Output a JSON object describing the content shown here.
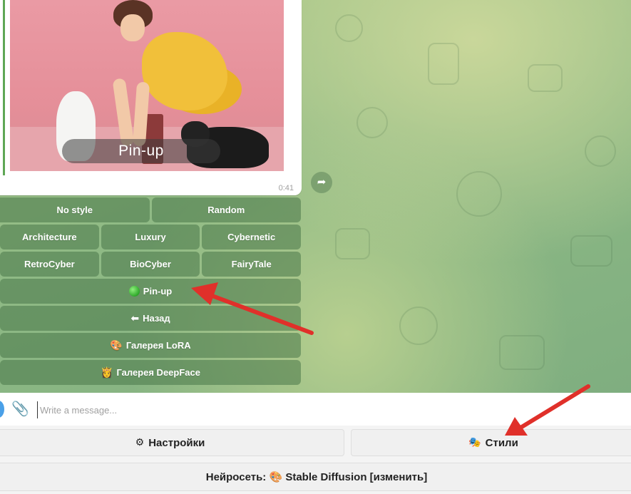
{
  "message": {
    "image_caption": "Pin-up",
    "time": "0:41"
  },
  "inline_keyboard": {
    "rows": [
      [
        "No style",
        "Random"
      ],
      [
        "Architecture",
        "Luxury",
        "Cybernetic"
      ],
      [
        "RetroCyber",
        "BioCyber",
        "FairyTale"
      ]
    ],
    "pinup": "Pin-up",
    "back": "Назад",
    "back_emoji": "⬅",
    "lora": "Галерея LoRA",
    "lora_emoji": "🎨",
    "deepface": "Галерея DeepFace",
    "deepface_emoji": "👸"
  },
  "composer": {
    "placeholder": "Write a message..."
  },
  "reply_keyboard": {
    "settings": "Настройки",
    "settings_emoji": "⚙",
    "styles": "Стили",
    "styles_emoji": "🎭",
    "network": "Нейросеть: 🎨 Stable Diffusion [изменить]"
  },
  "colors": {
    "annotation_arrow": "#e0302a",
    "keyboard_button": "#4f8a4f",
    "accent_green": "#5fa755"
  },
  "icons": {
    "forward": "forward-arrow-icon",
    "attach": "paperclip-icon",
    "pinup": "green-circle-icon"
  }
}
